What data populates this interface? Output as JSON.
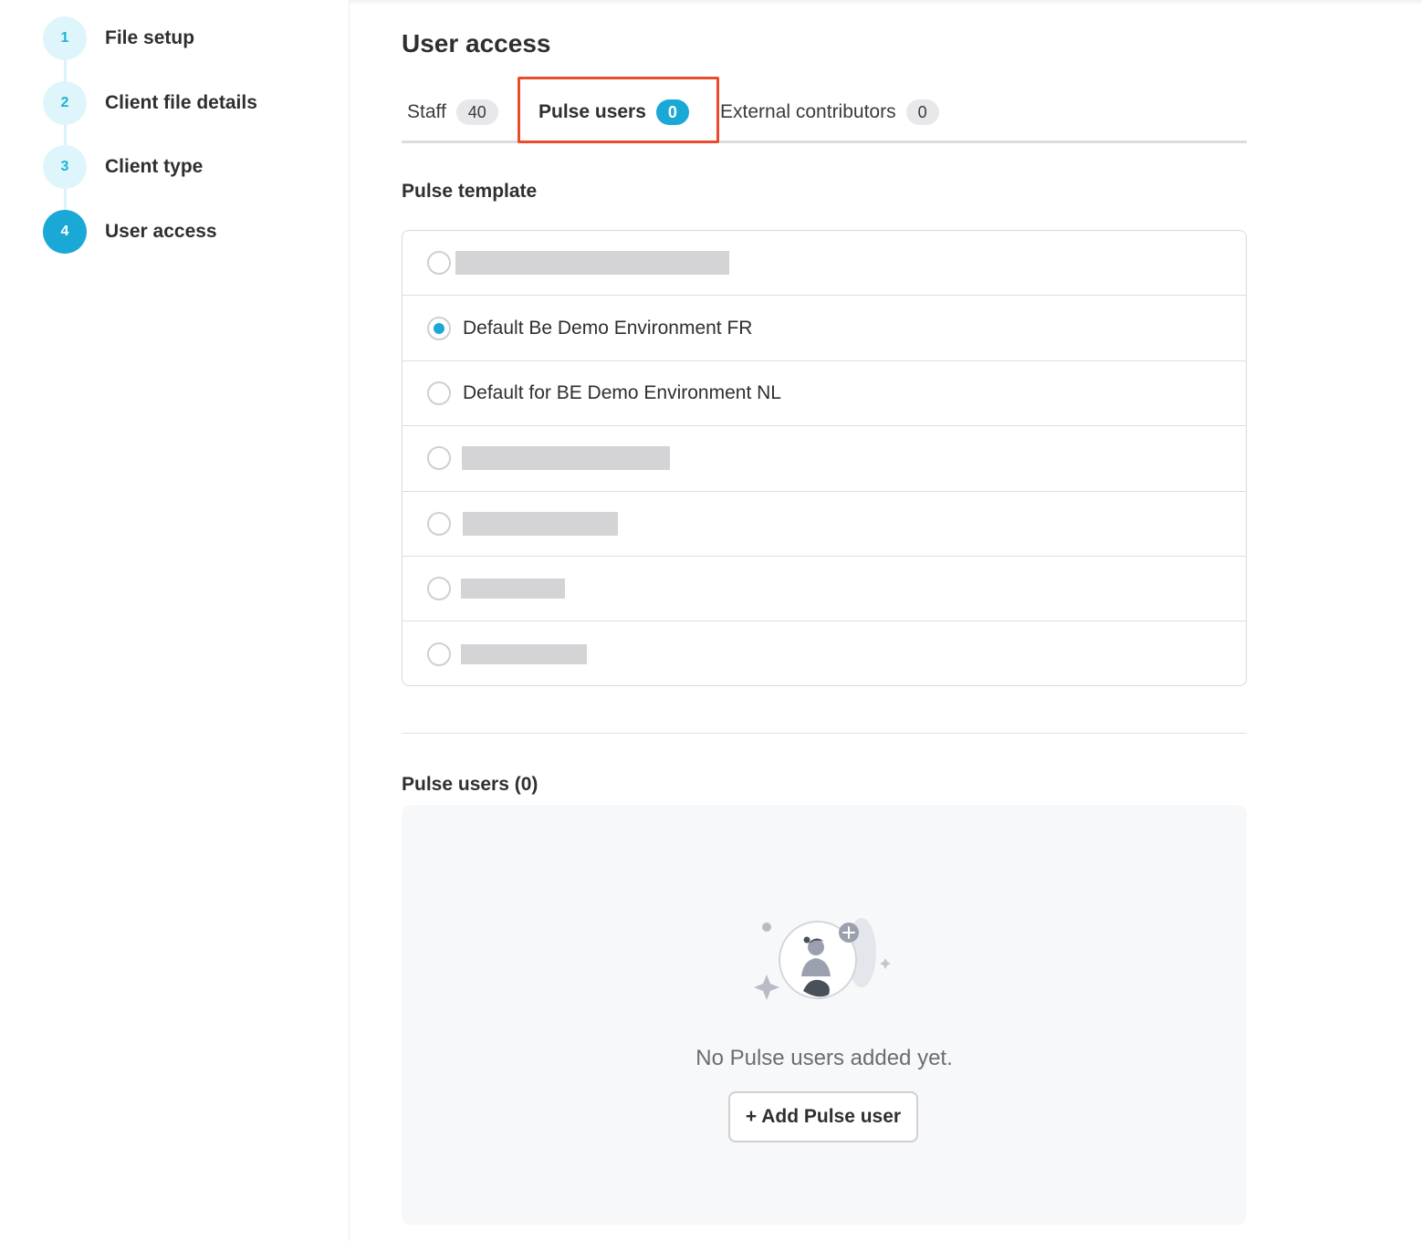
{
  "stepper": {
    "steps": [
      {
        "number": "1",
        "label": "File setup",
        "state": "completed"
      },
      {
        "number": "2",
        "label": "Client file details",
        "state": "completed"
      },
      {
        "number": "3",
        "label": "Client type",
        "state": "completed"
      },
      {
        "number": "4",
        "label": "User access",
        "state": "active"
      }
    ]
  },
  "page": {
    "title": "User access"
  },
  "tabs": [
    {
      "label": "Staff",
      "count": "40",
      "active": false
    },
    {
      "label": "Pulse users",
      "count": "0",
      "active": true
    },
    {
      "label": "External contributors",
      "count": "0",
      "active": false
    }
  ],
  "pulse_template": {
    "title": "Pulse template",
    "options": [
      {
        "label": "",
        "redacted": true,
        "selected": false
      },
      {
        "label": "Default Be Demo Environment FR",
        "redacted": false,
        "selected": true
      },
      {
        "label": "Default for BE Demo Environment NL",
        "redacted": false,
        "selected": false
      },
      {
        "label": "",
        "redacted": true,
        "selected": false
      },
      {
        "label": "",
        "redacted": true,
        "selected": false
      },
      {
        "label": "",
        "redacted": true,
        "selected": false
      },
      {
        "label": "",
        "redacted": true,
        "selected": false
      }
    ]
  },
  "pulse_users": {
    "title": "Pulse users (0)",
    "empty_message": "No Pulse users added yet.",
    "add_button_label": "+ Add Pulse user",
    "illustration_icon": "add-person-illustration-icon"
  },
  "colors": {
    "accent": "#1aa9d6",
    "highlight_box": "#ea4b2c",
    "step_inactive_bg": "#def6fb"
  }
}
